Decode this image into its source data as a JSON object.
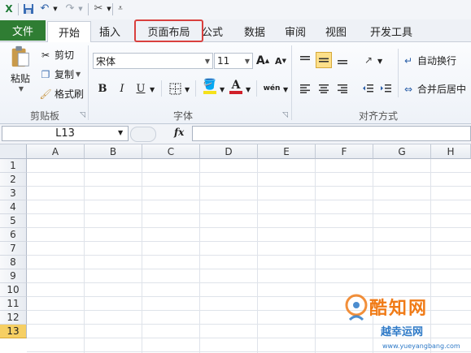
{
  "ribbon_tabs": {
    "file": "文件",
    "home": "开始",
    "insert": "插入",
    "page_layout": "页面布局",
    "formulas": "公式",
    "data": "数据",
    "review": "审阅",
    "view": "视图",
    "developer": "开发工具"
  },
  "clipboard": {
    "paste": "粘贴",
    "cut": "剪切",
    "copy": "复制",
    "format_painter": "格式刷",
    "group_label": "剪贴板"
  },
  "font": {
    "name": "宋体",
    "size": "11",
    "grow": "A",
    "shrink": "A",
    "bold": "B",
    "italic": "I",
    "underline": "U",
    "phonetic": "wén",
    "group_label": "字体"
  },
  "alignment": {
    "wrap_text": "自动换行",
    "merge_center": "合并后居中",
    "group_label": "对齐方式"
  },
  "formula_bar": {
    "name_box": "L13",
    "fx": "fx",
    "formula": ""
  },
  "grid": {
    "columns": [
      "A",
      "B",
      "C",
      "D",
      "E",
      "F",
      "G",
      "H"
    ],
    "rows": [
      "1",
      "2",
      "3",
      "4",
      "5",
      "6",
      "7",
      "8",
      "9",
      "10",
      "11",
      "12",
      "13"
    ],
    "selected_row": "13"
  },
  "watermark": {
    "brand": "酷知网",
    "sub": "越幸运网",
    "url": "www.yueyangbang.com"
  },
  "colors": {
    "file_tab": "#2f7d33",
    "highlight": "#d9403e",
    "selected_row": "#f6cf63",
    "font_color": "#d0202a",
    "fill_color": "#f5e11b"
  }
}
